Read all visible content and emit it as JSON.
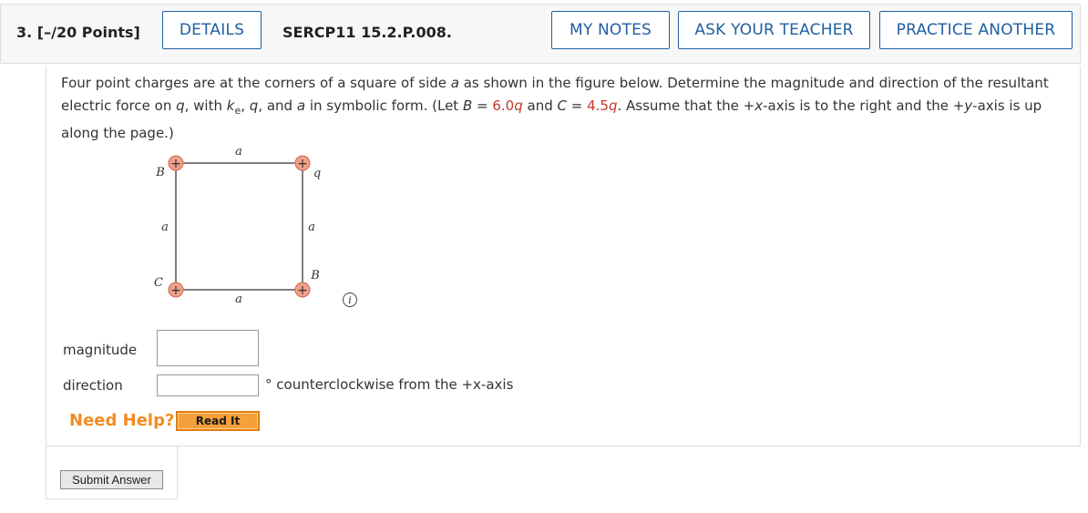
{
  "header": {
    "question_number": "3.",
    "points": "[–/20 Points]",
    "details_label": "DETAILS",
    "problem_code": "SERCP11 15.2.P.008.",
    "my_notes_label": "MY NOTES",
    "ask_teacher_label": "ASK YOUR TEACHER",
    "practice_another_label": "PRACTICE ANOTHER"
  },
  "problem": {
    "t1": "Four point charges are at the corners of a square of side ",
    "v_a": "a",
    "t2": " as shown in the figure below. Determine the magnitude and direction of the resultant electric force on ",
    "v_q": "q",
    "t3": ", with ",
    "v_k": "k",
    "v_e_sub": "e",
    "t4": ", ",
    "v_q2": "q",
    "t5": ", and ",
    "v_a2": "a",
    "t6": " in symbolic form. (Let ",
    "v_B": "B",
    "t7": " = ",
    "b_val": "6.0",
    "b_q": "q",
    "t8": " and ",
    "v_C": "C",
    "t9": " = ",
    "c_val": "4.5",
    "c_q": "q",
    "t10": ". Assume that the +",
    "v_x": "x",
    "t11": "-axis is to the right and the +",
    "v_y": "y",
    "t12": "-axis is up along the page.)"
  },
  "figure": {
    "top_side": "a",
    "bottom_side": "a",
    "left_side": "a",
    "right_side": "a",
    "top_left_charge": "B",
    "top_right_charge": "q",
    "bottom_left_charge": "C",
    "bottom_right_charge": "B",
    "plus_sign": "+",
    "info_symbol": "i"
  },
  "answers": {
    "magnitude_label": "magnitude",
    "magnitude_value": "",
    "direction_label": "direction",
    "direction_value": "",
    "direction_unit": "° counterclockwise from the +x-axis"
  },
  "help": {
    "need_help_label": "Need Help?",
    "read_it_label": "Read It"
  },
  "submit_label": "Submit Answer",
  "colors": {
    "accent_blue": "#1f5fa3",
    "value_red": "#c0392b",
    "help_orange": "#f28c22",
    "charge_fill": "#f0a08a"
  }
}
